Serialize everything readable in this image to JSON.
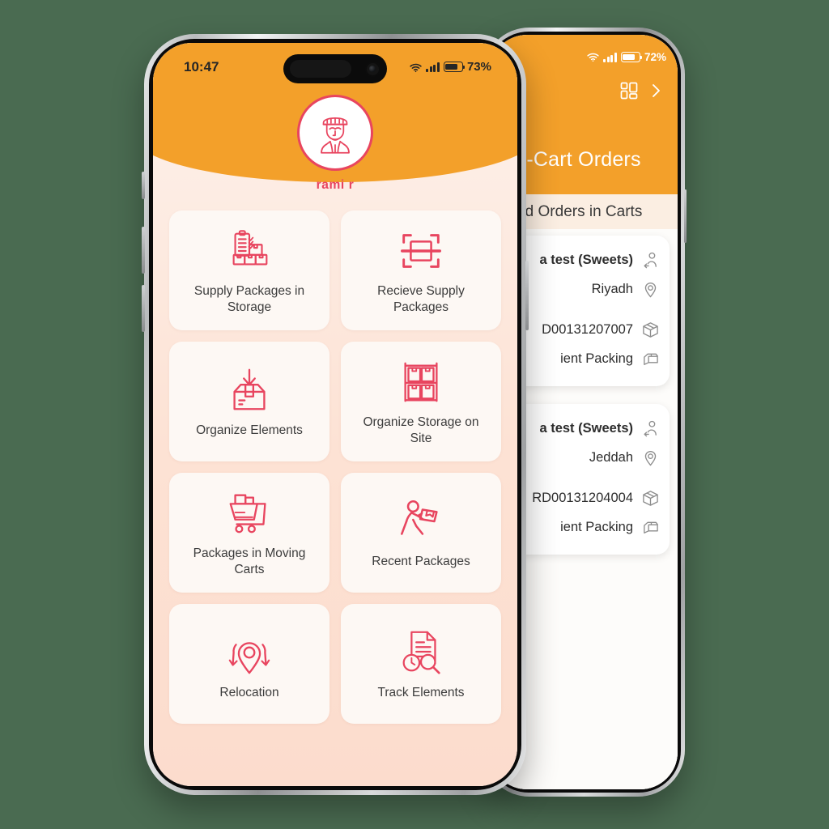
{
  "canvas": {
    "background": "#4a6b51"
  },
  "theme": {
    "orange": "#f3a02a",
    "accent_red": "#e8455f",
    "tile_bg": "#fdf8f4",
    "page_bg_top": "#fdf2ec",
    "page_bg_bottom": "#fcdccd"
  },
  "left_phone": {
    "status_bar": {
      "time": "10:47",
      "battery_percent": "73%",
      "wifi_icon": "wifi-icon",
      "cellular_icon": "cellular-signal-icon",
      "battery_icon": "battery-icon"
    },
    "profile": {
      "avatar_icon": "worker-avatar-icon",
      "name": "rami r"
    },
    "menu_tiles": [
      {
        "label": "Supply Packages in Storage",
        "icon": "clipboard-boxes-icon"
      },
      {
        "label": "Recieve Supply Packages",
        "icon": "scan-package-icon"
      },
      {
        "label": "Organize Elements",
        "icon": "box-arrow-down-icon"
      },
      {
        "label": "Organize Storage on Site",
        "icon": "shelf-boxes-icon"
      },
      {
        "label": "Packages in Moving Carts",
        "icon": "shopping-cart-icon"
      },
      {
        "label": "Recent Packages",
        "icon": "worker-carrying-box-icon"
      },
      {
        "label": "Relocation",
        "icon": "location-relocate-icon"
      },
      {
        "label": "Track Elements",
        "icon": "document-clock-search-icon"
      }
    ]
  },
  "right_phone": {
    "status_bar": {
      "battery_percent": "72%",
      "wifi_icon": "wifi-icon",
      "cellular_icon": "cellular-signal-icon",
      "battery_icon": "battery-icon"
    },
    "toolbar": {
      "grid_icon": "grid-dashboard-icon",
      "chevron_icon": "chevron-right-icon"
    },
    "title": "-Cart Orders",
    "subtitle": "d Orders in Carts",
    "orders": [
      {
        "customer": "a test (Sweets)",
        "customer_icon": "person-arrow-icon",
        "city": "Riyadh",
        "city_icon": "location-pin-icon",
        "code": "D00131207007",
        "code_icon": "package-box-icon",
        "status": "ient Packing",
        "status_icon": "packing-icon"
      },
      {
        "customer": "a test (Sweets)",
        "customer_icon": "person-arrow-icon",
        "city": "Jeddah",
        "city_icon": "location-pin-icon",
        "code": "RD00131204004",
        "code_icon": "package-box-icon",
        "status": "ient Packing",
        "status_icon": "packing-icon"
      }
    ]
  }
}
